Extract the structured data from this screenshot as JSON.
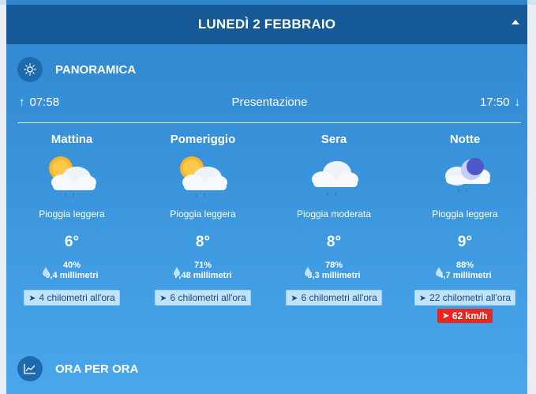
{
  "header": {
    "date": "LUNEDÌ 2 FEBBRAIO"
  },
  "overview": {
    "title": "PANORAMICA",
    "sunrise": "07:58",
    "summary_label": "Presentazione",
    "sunset": "17:50"
  },
  "periods": [
    {
      "name": "Mattina",
      "icon": "partly-sunny-rain-icon",
      "condition": "Pioggia leggera",
      "temperature": "6°",
      "precip_prob": "40%",
      "precip_amount": "0,4 millimetri",
      "wind": "4 chilometri all'ora",
      "gust": ""
    },
    {
      "name": "Pomeriggio",
      "icon": "partly-sunny-rain-icon",
      "condition": "Pioggia leggera",
      "temperature": "8°",
      "precip_prob": "71%",
      "precip_amount": "7,48 millimetri",
      "wind": "6 chilometri all'ora",
      "gust": ""
    },
    {
      "name": "Sera",
      "icon": "cloud-rain-icon",
      "condition": "Pioggia moderata",
      "temperature": "8°",
      "precip_prob": "78%",
      "precip_amount": "8,3 millimetri",
      "wind": "6 chilometri all'ora",
      "gust": ""
    },
    {
      "name": "Notte",
      "icon": "moon-cloud-rain-icon",
      "condition": "Pioggia leggera",
      "temperature": "9°",
      "precip_prob": "88%",
      "precip_amount": "4,7 millimetri",
      "wind": "22 chilometri all'ora",
      "gust": "62 km/h"
    }
  ],
  "hourly": {
    "title": "ORA PER ORA"
  },
  "colors": {
    "header_bg": "#155a97",
    "gust_bg": "#e8281e",
    "wind_chip_bg": "#bfe3fb"
  }
}
